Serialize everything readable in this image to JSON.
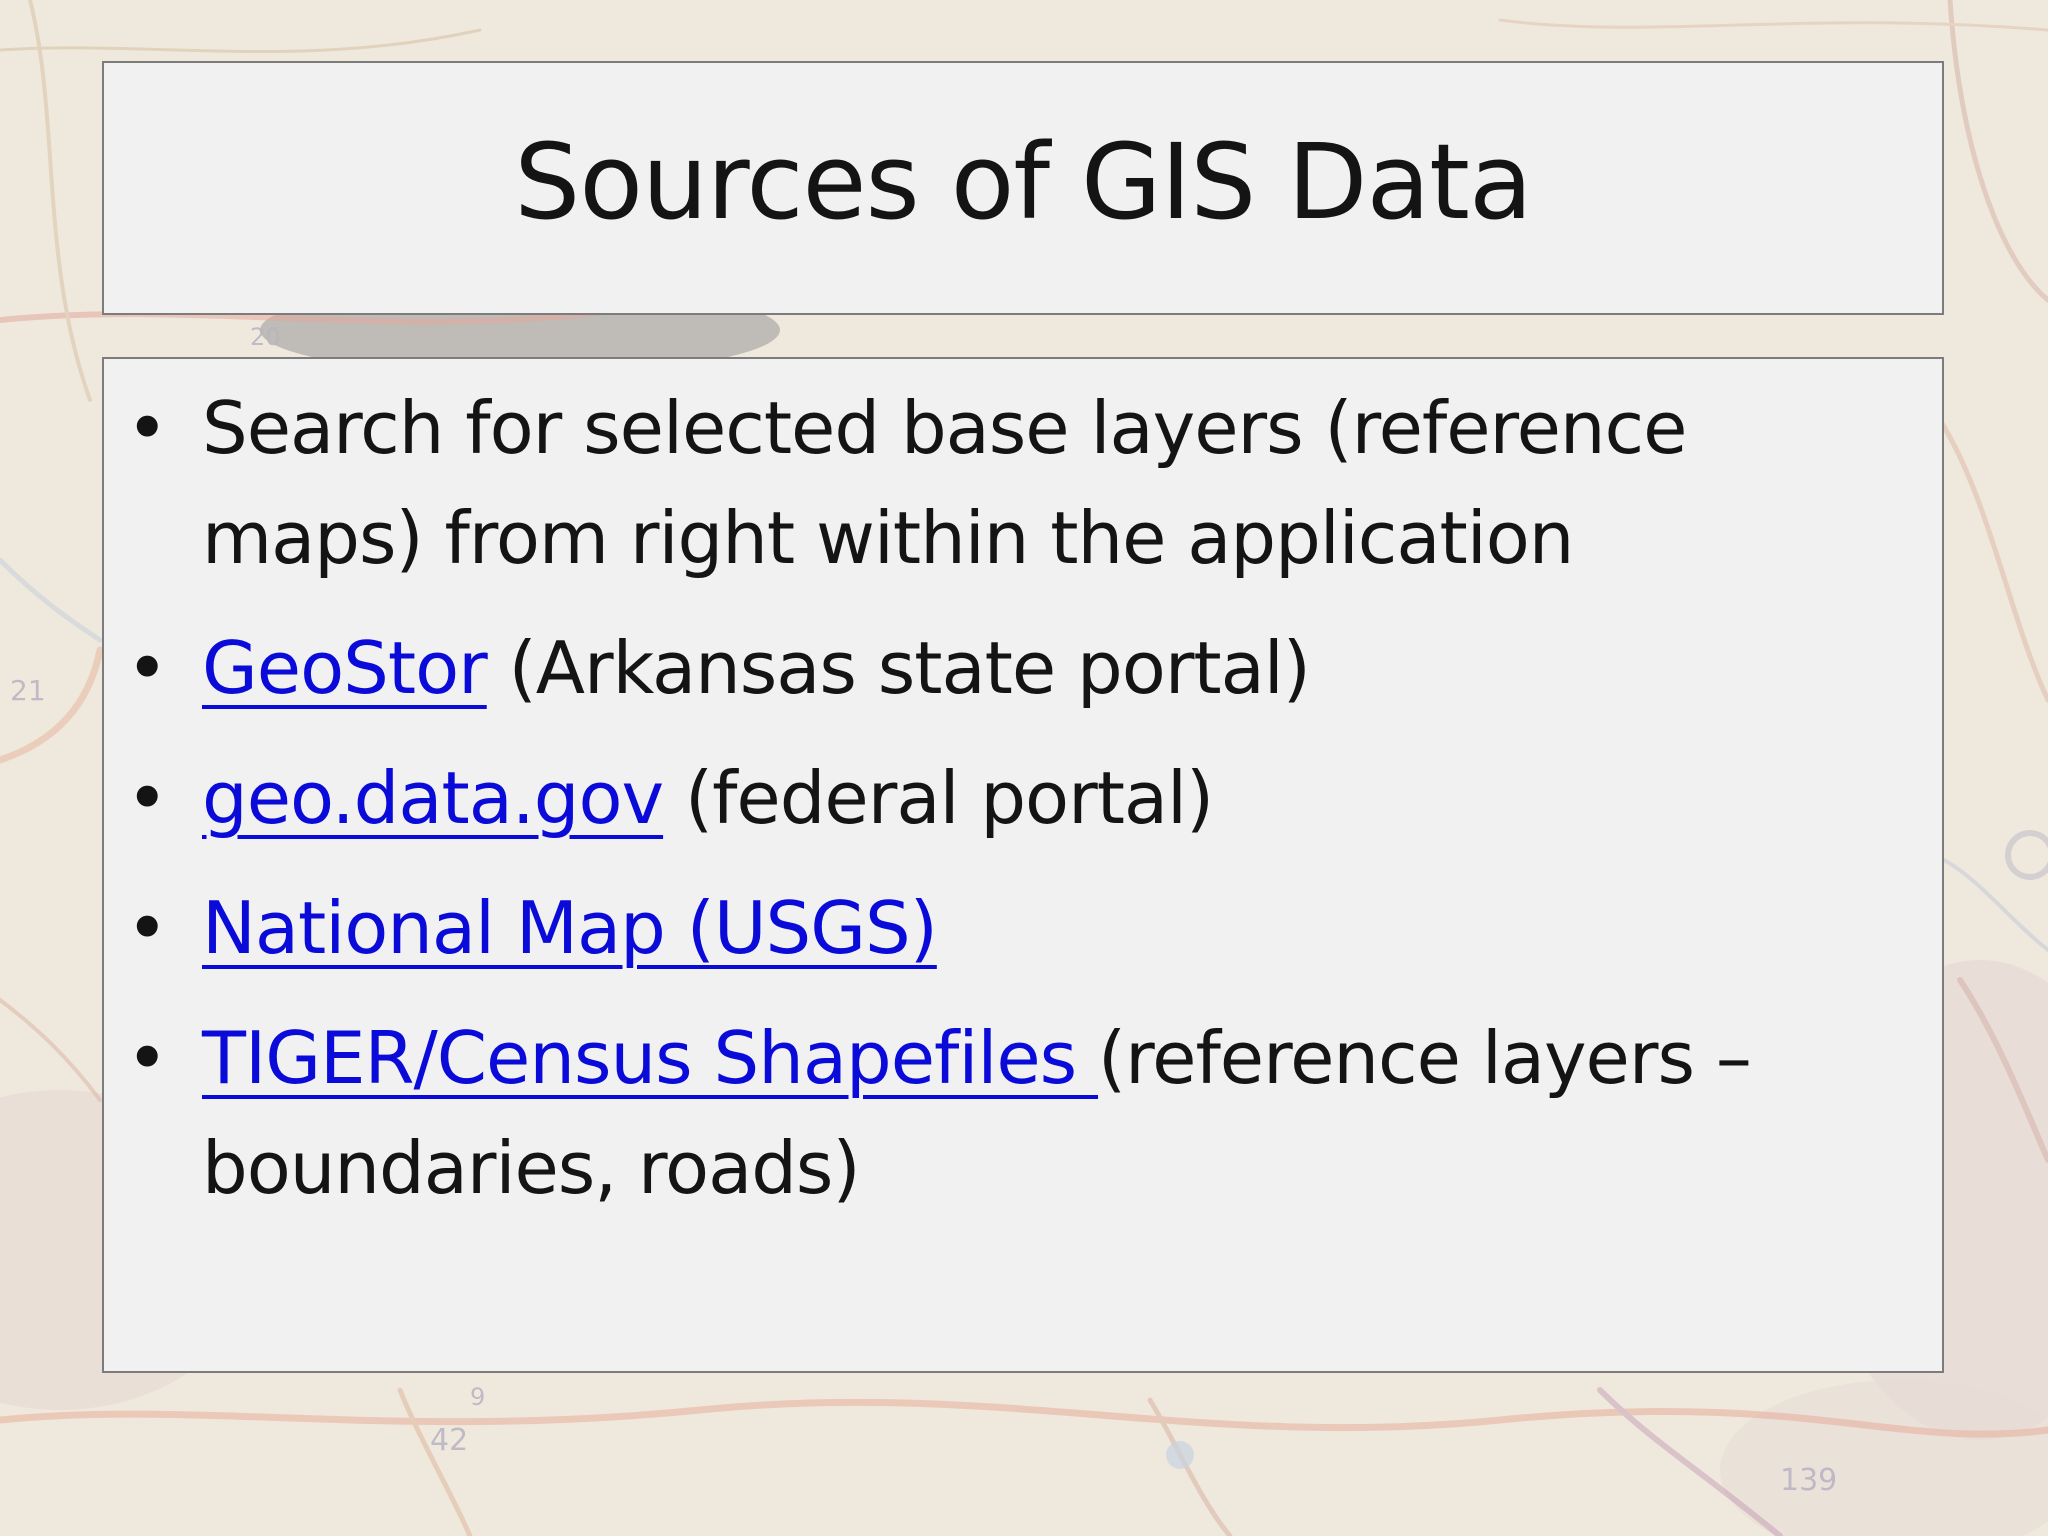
{
  "slide": {
    "title": "Sources of GIS Data",
    "bullets": [
      {
        "text": "Search for selected base layers (reference maps) from right within the application"
      },
      {
        "link": "GeoStor",
        "text": " (Arkansas state portal)"
      },
      {
        "link": "geo.data.gov",
        "text": " (federal portal)"
      },
      {
        "link": "National Map (USGS)",
        "text": ""
      },
      {
        "link": "TIGER/Census Shapefiles ",
        "text": "(reference layers – boundaries, roads)"
      }
    ],
    "bullet_glyph": "•"
  },
  "background": {
    "label_1": "20",
    "label_2": "21",
    "label_3": "42",
    "label_4": "139",
    "label_5": "9"
  },
  "colors": {
    "link": "#0b0bd9",
    "text": "#141414",
    "panel": "#f2f1f2",
    "border": "#7c7c7c"
  }
}
